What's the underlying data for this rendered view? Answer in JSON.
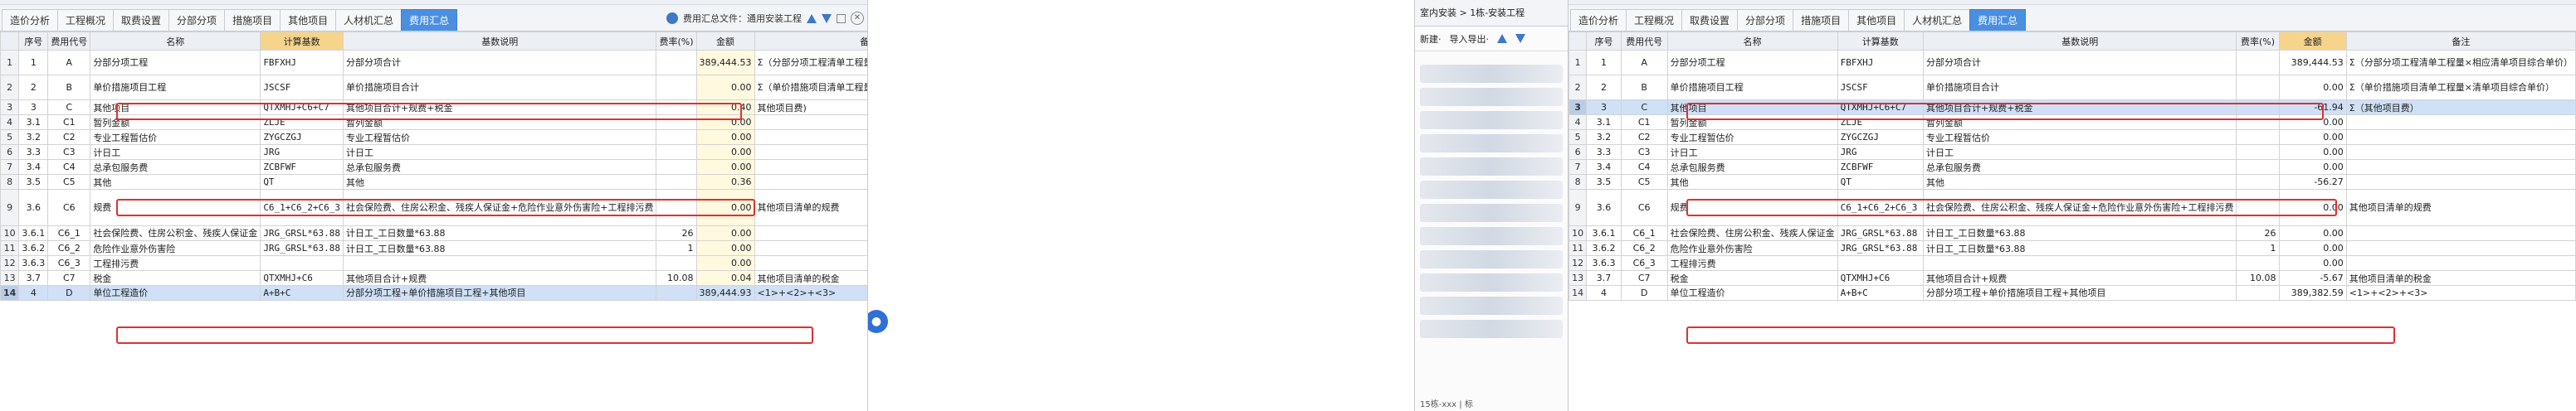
{
  "left": {
    "tabs": [
      "造价分析",
      "工程概况",
      "取费设置",
      "分部分项",
      "措施项目",
      "其他项目",
      "人材机汇总",
      "费用汇总"
    ],
    "active_tab": 7,
    "template_label": "费用汇总文件：通用安装工程",
    "columns": [
      "",
      "序号",
      "费用代号",
      "名称",
      "计算基数",
      "基数说明",
      "费率(%)",
      "金额",
      "备注"
    ],
    "rows": [
      {
        "n": "1",
        "seq": "1",
        "code": "A",
        "name": "分部分项工程",
        "base": "FBFXHJ",
        "desc": "分部分项合计",
        "rate": "",
        "amount": "389,444.53",
        "note": "Σ（分部分项工程清单工程量×相应清单项目综合单价）"
      },
      {
        "n": "2",
        "seq": "2",
        "code": "B",
        "name": "单价措施项目工程",
        "base": "JSCSF",
        "desc": "单价措施项目合计",
        "rate": "",
        "amount": "0.00",
        "note": "Σ（单价措施项目清单工程量×清单项目综合单价）"
      },
      {
        "n": "3",
        "seq": "3",
        "code": "C",
        "name": "其他项目",
        "base": "QTXMHJ+C6+C7",
        "desc": "其他项目合计+规费+税金",
        "rate": "",
        "amount": "0.40",
        "note": "其他项目费)"
      },
      {
        "n": "4",
        "seq": "3.1",
        "code": "C1",
        "name": "暂列金额",
        "base": "ZLJE",
        "desc": "暂列金额",
        "rate": "",
        "amount": "0.00",
        "note": ""
      },
      {
        "n": "5",
        "seq": "3.2",
        "code": "C2",
        "name": "专业工程暂估价",
        "base": "ZYGCZGJ",
        "desc": "专业工程暂估价",
        "rate": "",
        "amount": "0.00",
        "note": ""
      },
      {
        "n": "6",
        "seq": "3.3",
        "code": "C3",
        "name": "计日工",
        "base": "JRG",
        "desc": "计日工",
        "rate": "",
        "amount": "0.00",
        "note": ""
      },
      {
        "n": "7",
        "seq": "3.4",
        "code": "C4",
        "name": "总承包服务费",
        "base": "ZCBFWF",
        "desc": "总承包服务费",
        "rate": "",
        "amount": "0.00",
        "note": ""
      },
      {
        "n": "8",
        "seq": "3.5",
        "code": "C5",
        "name": "其他",
        "base": "QT",
        "desc": "其他",
        "rate": "",
        "amount": "0.36",
        "note": ""
      },
      {
        "n": "9",
        "seq": "3.6",
        "code": "C6",
        "name": "规费",
        "base": "C6_1+C6_2+C6_3",
        "desc": "社会保险费、住房公积金、残疾人保证金+危险作业意外伤害险+工程排污费",
        "rate": "",
        "amount": "0.00",
        "note": "其他项目清单的规费"
      },
      {
        "n": "10",
        "seq": "3.6.1",
        "code": "C6_1",
        "name": "社会保险费、住房公积金、残疾人保证金",
        "base": "JRG_GRSL*63.88",
        "desc": "计日工_工日数量*63.88",
        "rate": "26",
        "amount": "0.00",
        "note": ""
      },
      {
        "n": "11",
        "seq": "3.6.2",
        "code": "C6_2",
        "name": "危险作业意外伤害险",
        "base": "JRG_GRSL*63.88",
        "desc": "计日工_工日数量*63.88",
        "rate": "1",
        "amount": "0.00",
        "note": ""
      },
      {
        "n": "12",
        "seq": "3.6.3",
        "code": "C6_3",
        "name": "工程排污费",
        "base": "",
        "desc": "",
        "rate": "",
        "amount": "0.00",
        "note": ""
      },
      {
        "n": "13",
        "seq": "3.7",
        "code": "C7",
        "name": "税金",
        "base": "QTXMHJ+C6",
        "desc": "其他项目合计+规费",
        "rate": "10.08",
        "amount": "0.04",
        "note": "其他项目清单的税金"
      },
      {
        "n": "14",
        "seq": "4",
        "code": "D",
        "name": "单位工程造价",
        "base": "A+B+C",
        "desc": "分部分项工程+单价措施项目工程+其他项目",
        "rate": "",
        "amount": "389,444.93",
        "note": "<1>+<2>+<3>"
      }
    ]
  },
  "mid": {
    "title": "室内安装 > 1栋-安装工程",
    "new_label": "新建·",
    "import_label": "导入导出·",
    "footer": "15栋-xxx | 标"
  },
  "right": {
    "tabs": [
      "造价分析",
      "工程概况",
      "取费设置",
      "分部分项",
      "措施项目",
      "其他项目",
      "人材机汇总",
      "费用汇总"
    ],
    "active_tab": 7,
    "columns": [
      "",
      "序号",
      "费用代号",
      "名称",
      "计算基数",
      "基数说明",
      "费率(%)",
      "金额",
      "备注"
    ],
    "rows": [
      {
        "n": "1",
        "seq": "1",
        "code": "A",
        "name": "分部分项工程",
        "base": "FBFXHJ",
        "desc": "分部分项合计",
        "rate": "",
        "amount": "389,444.53",
        "note": "Σ（分部分项工程清单工程量×相应清单项目综合单价）"
      },
      {
        "n": "2",
        "seq": "2",
        "code": "B",
        "name": "单价措施项目工程",
        "base": "JSCSF",
        "desc": "单价措施项目合计",
        "rate": "",
        "amount": "0.00",
        "note": "Σ（单价措施项目清单工程量×清单项目综合单价）"
      },
      {
        "n": "3",
        "seq": "3",
        "code": "C",
        "name": "其他项目",
        "base": "QTXMHJ+C6+C7",
        "desc": "其他项目合计+规费+税金",
        "rate": "",
        "amount": "-61.94",
        "note": "Σ（其他项目费）"
      },
      {
        "n": "4",
        "seq": "3.1",
        "code": "C1",
        "name": "暂列金额",
        "base": "ZLJE",
        "desc": "暂列金额",
        "rate": "",
        "amount": "0.00",
        "note": ""
      },
      {
        "n": "5",
        "seq": "3.2",
        "code": "C2",
        "name": "专业工程暂估价",
        "base": "ZYGCZGJ",
        "desc": "专业工程暂估价",
        "rate": "",
        "amount": "0.00",
        "note": ""
      },
      {
        "n": "6",
        "seq": "3.3",
        "code": "C3",
        "name": "计日工",
        "base": "JRG",
        "desc": "计日工",
        "rate": "",
        "amount": "0.00",
        "note": ""
      },
      {
        "n": "7",
        "seq": "3.4",
        "code": "C4",
        "name": "总承包服务费",
        "base": "ZCBFWF",
        "desc": "总承包服务费",
        "rate": "",
        "amount": "0.00",
        "note": ""
      },
      {
        "n": "8",
        "seq": "3.5",
        "code": "C5",
        "name": "其他",
        "base": "QT",
        "desc": "其他",
        "rate": "",
        "amount": "-56.27",
        "note": ""
      },
      {
        "n": "9",
        "seq": "3.6",
        "code": "C6",
        "name": "规费",
        "base": "C6_1+C6_2+C6_3",
        "desc": "社会保险费、住房公积金、残疾人保证金+危险作业意外伤害险+工程排污费",
        "rate": "",
        "amount": "0.00",
        "note": "其他项目清单的规费"
      },
      {
        "n": "10",
        "seq": "3.6.1",
        "code": "C6_1",
        "name": "社会保险费、住房公积金、残疾人保证金",
        "base": "JRG_GRSL*63.88",
        "desc": "计日工_工日数量*63.88",
        "rate": "26",
        "amount": "0.00",
        "note": ""
      },
      {
        "n": "11",
        "seq": "3.6.2",
        "code": "C6_2",
        "name": "危险作业意外伤害险",
        "base": "JRG_GRSL*63.88",
        "desc": "计日工_工日数量*63.88",
        "rate": "1",
        "amount": "0.00",
        "note": ""
      },
      {
        "n": "12",
        "seq": "3.6.3",
        "code": "C6_3",
        "name": "工程排污费",
        "base": "",
        "desc": "",
        "rate": "",
        "amount": "0.00",
        "note": ""
      },
      {
        "n": "13",
        "seq": "3.7",
        "code": "C7",
        "name": "税金",
        "base": "QTXMHJ+C6",
        "desc": "其他项目合计+规费",
        "rate": "10.08",
        "amount": "-5.67",
        "note": "其他项目清单的税金"
      },
      {
        "n": "14",
        "seq": "4",
        "code": "D",
        "name": "单位工程造价",
        "base": "A+B+C",
        "desc": "分部分项工程+单价措施项目工程+其他项目",
        "rate": "",
        "amount": "389,382.59",
        "note": "<1>+<2>+<3>"
      }
    ]
  },
  "colors": {
    "active_tab": "#4a8fe0",
    "selected_row": "#cfe0f7",
    "highlight_header": "#f6d48c",
    "annotation": "#e03030",
    "chat": "#2f6fd6"
  },
  "icons": [
    "info-circle-icon",
    "arrow-up-icon",
    "arrow-down-icon",
    "settings-icon",
    "close-icon",
    "chat-icon"
  ]
}
